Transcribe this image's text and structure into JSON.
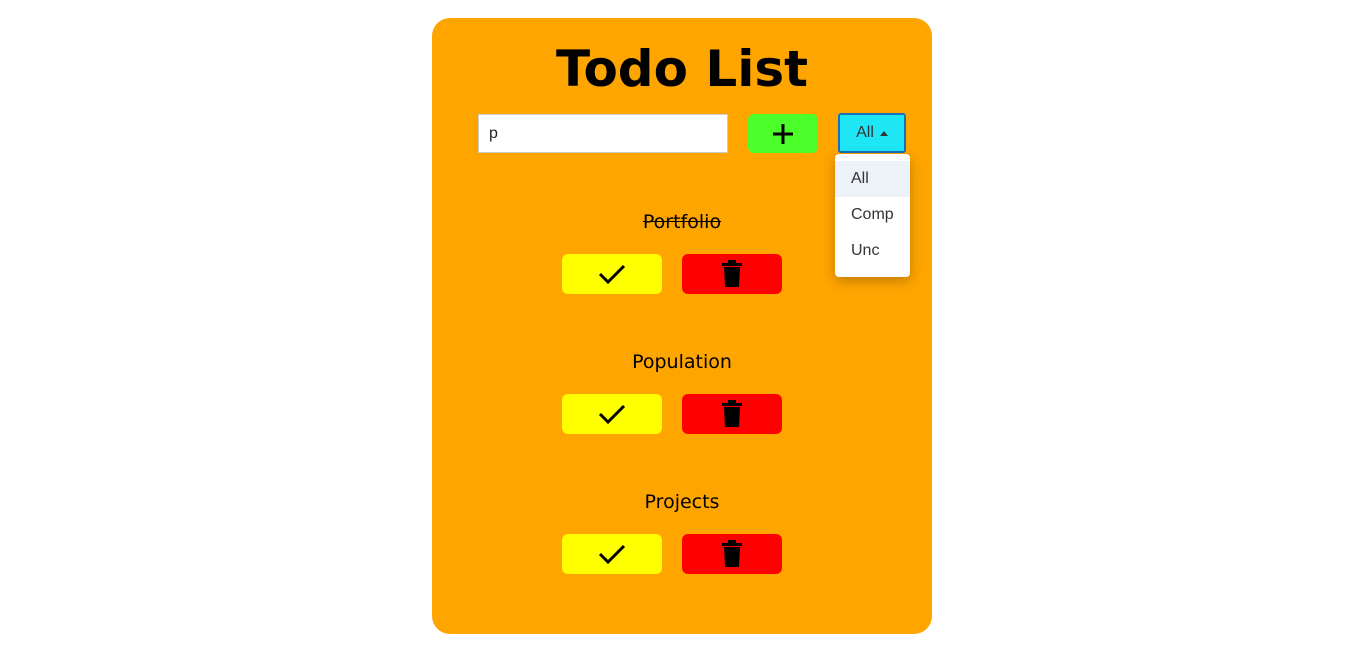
{
  "header": {
    "title": "Todo List"
  },
  "form": {
    "input_value": "p",
    "add_icon": "plus-icon",
    "filter_selected": "All"
  },
  "filter_menu": {
    "options": [
      "All",
      "Comp",
      "Unc"
    ],
    "highlighted": "All"
  },
  "todos": [
    {
      "text": "Portfolio",
      "completed": true
    },
    {
      "text": "Population",
      "completed": false
    },
    {
      "text": "Projects",
      "completed": false
    }
  ],
  "icons": {
    "complete": "check-icon",
    "delete": "trash-icon"
  },
  "colors": {
    "card": "#ffa500",
    "add_button": "#4cff2b",
    "filter": "#1ee6f5",
    "complete_button": "#ffff00",
    "delete_button": "#ff0000"
  }
}
